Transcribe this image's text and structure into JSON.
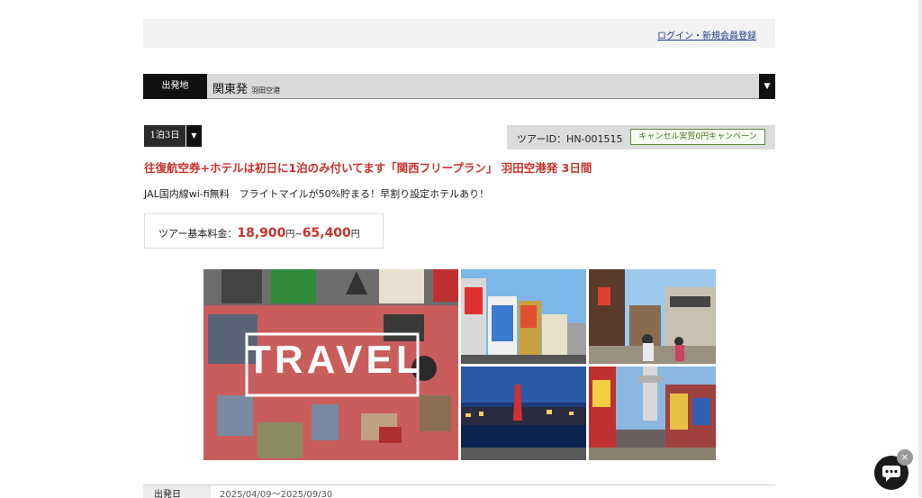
{
  "header": {
    "login_link": "ログイン・新規会員登録"
  },
  "origin": {
    "label": "出発地",
    "value": "関東発",
    "sub": "羽田空港",
    "arrow": "▼"
  },
  "duration": {
    "value": "1泊3日",
    "arrow": "▼"
  },
  "tour": {
    "id_text": "ツアーID：HN-001515",
    "campaign": "キャンセル実質0円キャンペーン",
    "title": "往復航空券+ホテルは初日に1泊のみ付いてます「関西フリープラン」 羽田空港発 3日間",
    "description": "JAL国内線wi-fi無料　フライトマイルが50%貯まる！早割り設定ホテルあり！",
    "price_label": "ツアー基本料金：",
    "price_min": "18,900",
    "price_max": "65,400",
    "price_unit": "円",
    "price_sep": "円~"
  },
  "gallery": {
    "main_text": "TRAVEL"
  },
  "schedule": {
    "label": "出発日",
    "value": "2025/04/09～2025/09/30"
  },
  "colors": {
    "accent": "#c8322a",
    "dark": "#111111",
    "badge_green": "#4a7a2a"
  },
  "icons": {
    "chat": "chat-bubble-icon",
    "close": "close-icon",
    "dropdown": "caret-down-icon"
  },
  "chat": {
    "close": "×"
  }
}
